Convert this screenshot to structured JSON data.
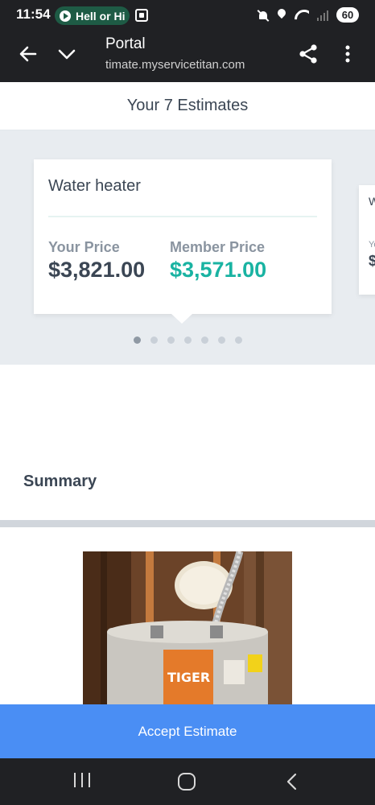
{
  "status_bar": {
    "time": "11:54",
    "media_text": "Hell or Hi",
    "battery": "60"
  },
  "browser": {
    "title": "Portal",
    "url": "timate.myservicetitan.com"
  },
  "estimates": {
    "header": "Your 7 Estimates",
    "total_pages": 7,
    "active_page": 1,
    "cards": [
      {
        "title": "Water heater",
        "your_price_label": "Your Price",
        "your_price": "$3,821.00",
        "member_price_label": "Member Price",
        "member_price": "$3,571.00"
      },
      {
        "title": "W",
        "your_price_label": "Yo",
        "your_price": "$"
      }
    ]
  },
  "summary": {
    "heading": "Summary"
  },
  "actions": {
    "accept_label": "Accept Estimate"
  },
  "colors": {
    "accent_teal": "#19b3a2",
    "accept_blue": "#4a8ef4",
    "text_dark": "#3b4654"
  }
}
